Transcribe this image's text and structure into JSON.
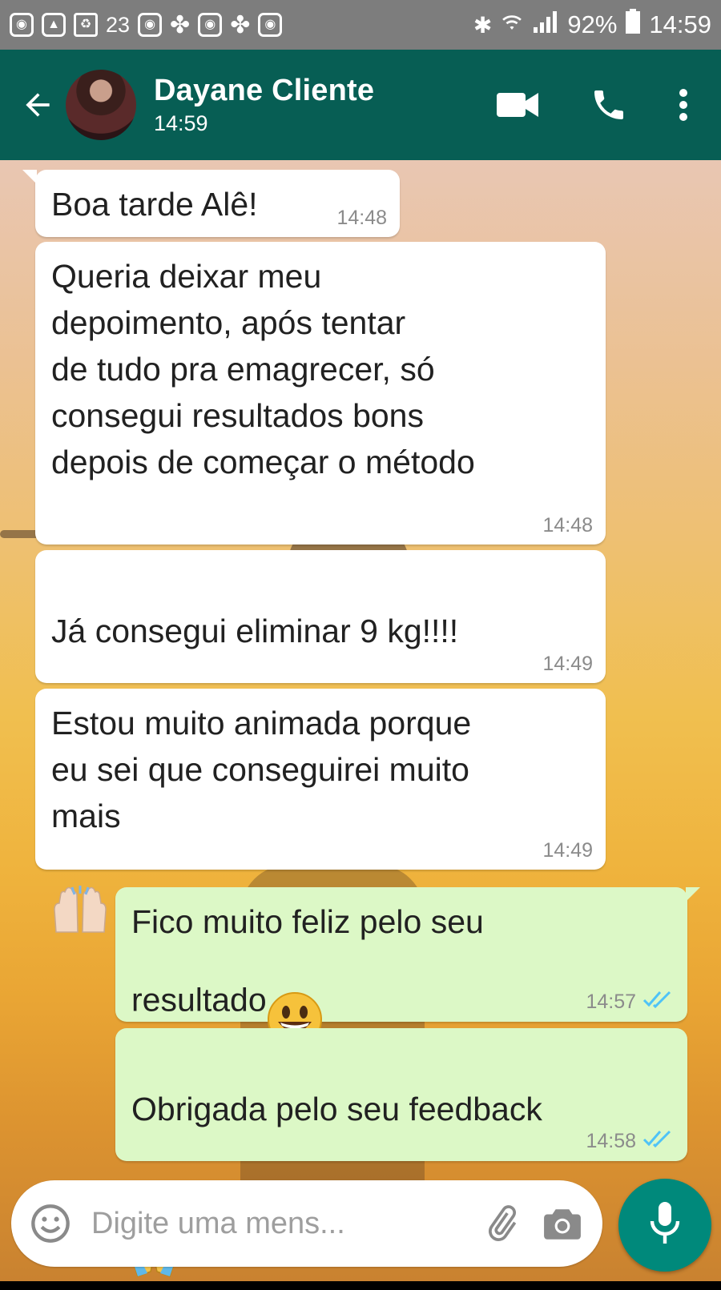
{
  "status_bar": {
    "left_icons": [
      "instagram-icon",
      "image-icon",
      "battery-saver-icon",
      "instagram-icon",
      "pinwheel-icon",
      "instagram-icon",
      "pinwheel-icon",
      "instagram-icon"
    ],
    "notification_count": "23",
    "battery_percent": "92%",
    "clock": "14:59"
  },
  "header": {
    "contact_name": "Dayane Cliente",
    "contact_status": "14:59",
    "icons": [
      "back-arrow-icon",
      "video-call-icon",
      "phone-icon",
      "more-vert-icon"
    ],
    "bar_color": "#075e54"
  },
  "messages": [
    {
      "direction": "incoming",
      "text": "Boa tarde Alê!",
      "time": "14:48"
    },
    {
      "direction": "incoming",
      "text": "Queria deixar meu\ndepoimento, após tentar\nde tudo pra emagrecer, só\nconsegui resultados bons\ndepois de começar o método",
      "time": "14:48"
    },
    {
      "direction": "incoming",
      "text": "Já consegui eliminar 9 kg!!!!",
      "emoji": "grinning-face",
      "time": "14:49"
    },
    {
      "direction": "incoming",
      "text": "Estou muito animada porque\neu sei que conseguirei muito\nmais",
      "emoji": "raising-hands",
      "time": "14:49"
    },
    {
      "direction": "outgoing",
      "text": "Fico muito feliz pelo seu\nresultado",
      "emoji": "grinning-face",
      "time": "14:57",
      "status": "double-check-read"
    },
    {
      "direction": "outgoing",
      "text": "Obrigada pelo seu feedback",
      "emoji": "folded-hands",
      "time": "14:58",
      "status": "double-check-read"
    }
  ],
  "input": {
    "placeholder": "Digite uma mens...",
    "icons": [
      "emoji-icon",
      "attach-icon",
      "camera-icon",
      "mic-icon"
    ]
  },
  "colors": {
    "incoming_bubble": "#ffffff",
    "outgoing_bubble": "#dcf8c6",
    "read_ticks": "#4fc3f7",
    "mic_button": "#00897b"
  }
}
